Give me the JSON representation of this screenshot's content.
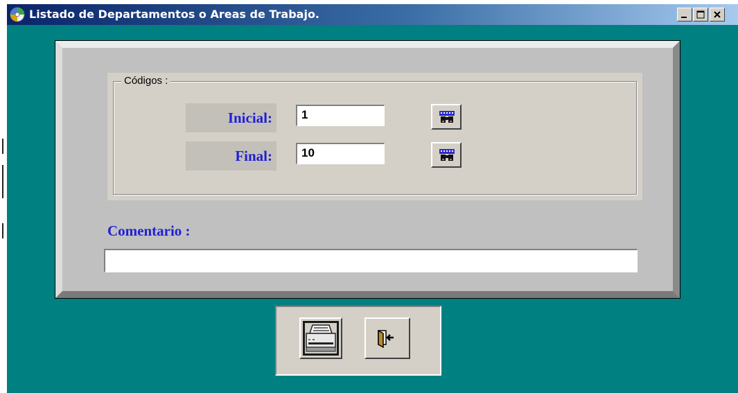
{
  "window": {
    "title": "Listado de Departamentos o Areas de Trabajo.",
    "icons": [
      "app-icon",
      "minimize-icon",
      "maximize-icon",
      "close-icon"
    ]
  },
  "codes": {
    "legend": "Códigos :",
    "initial_label": "Inicial:",
    "initial_value": "1",
    "final_label": "Final:",
    "final_value": "10",
    "search_icon": "binoculars-icon"
  },
  "comment": {
    "label": "Comentario :",
    "value": ""
  },
  "toolbar": {
    "print_icon": "printer-icon",
    "exit_icon": "exit-door-icon"
  },
  "colors": {
    "background": "#008080",
    "label_blue": "#1f1fd6",
    "panel": "#c0c0c0",
    "face": "#d4d0c8"
  }
}
